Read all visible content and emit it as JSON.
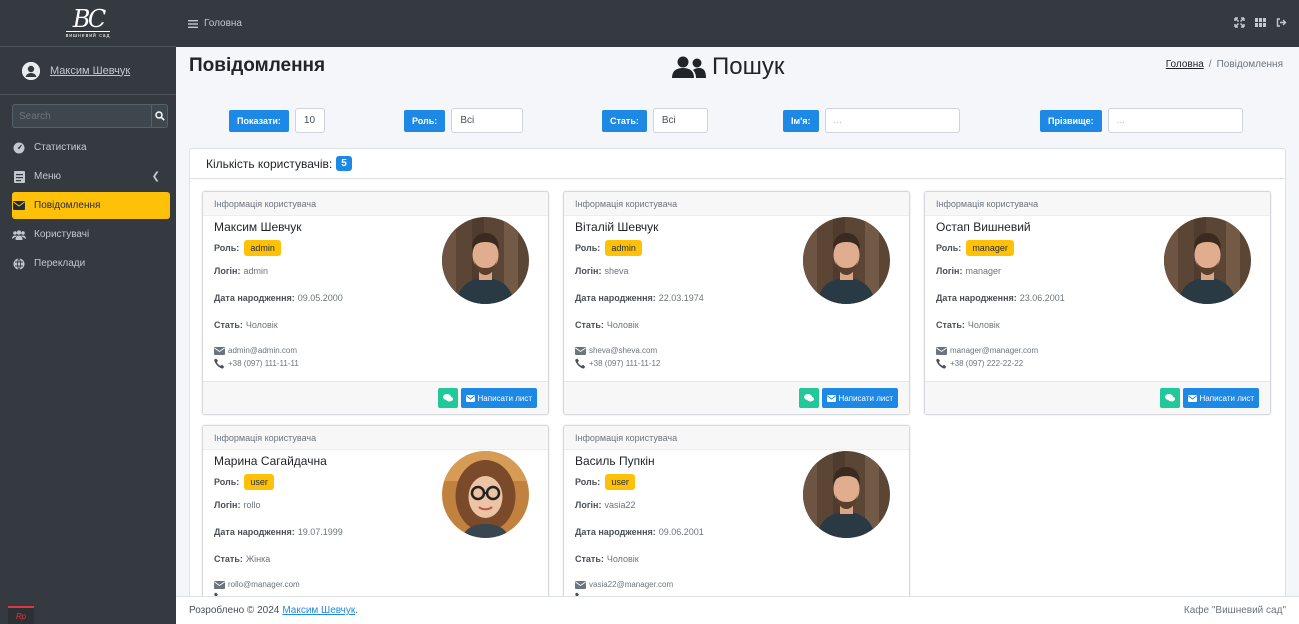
{
  "brand": {
    "logo_text": "BC",
    "logo_sub": "вишневий сад"
  },
  "sidebar": {
    "user_name": "Максим Шевчук",
    "search_placeholder": "Search",
    "items": [
      {
        "label": "Статистика",
        "icon": "gauge-icon",
        "active": false
      },
      {
        "label": "Меню",
        "icon": "list-icon",
        "active": false
      },
      {
        "label": "Повідомлення",
        "icon": "envelope-icon",
        "active": true
      },
      {
        "label": "Користувачі",
        "icon": "users-icon",
        "active": false
      },
      {
        "label": "Переклади",
        "icon": "globe-icon",
        "active": false
      }
    ]
  },
  "topbar": {
    "home_label": "Головна"
  },
  "page": {
    "title": "Повідомлення",
    "center_title": "Пошук",
    "breadcrumb": {
      "home": "Головна",
      "separator": "/",
      "current": "Повідомлення"
    }
  },
  "filters": {
    "show": {
      "label": "Показати:",
      "value": "10"
    },
    "role": {
      "label": "Роль:",
      "value": "Всі"
    },
    "sex": {
      "label": "Стать:",
      "value": "Всі"
    },
    "name": {
      "label": "Ім'я:",
      "placeholder": "..."
    },
    "surname": {
      "label": "Прізвище:",
      "placeholder": "..."
    }
  },
  "panel": {
    "count_label": "Кількість користувачів:",
    "count": "5"
  },
  "card_labels": {
    "header": "Інформація користувача",
    "role": "Роль:",
    "login": "Логін:",
    "birth": "Дата народження:",
    "sex": "Стать:",
    "write_button": "Написати лист"
  },
  "users": [
    {
      "name": "Максим Шевчук",
      "role": "admin",
      "login": "admin",
      "birth": "09.05.2000",
      "sex": "Чоловік",
      "email": "admin@admin.com",
      "phone": "+38 (097) 111-11-11",
      "photo": "man"
    },
    {
      "name": "Віталій Шевчук",
      "role": "admin",
      "login": "sheva",
      "birth": "22.03.1974",
      "sex": "Чоловік",
      "email": "sheva@sheva.com",
      "phone": "+38 (097) 111-11-12",
      "photo": "man"
    },
    {
      "name": "Остап Вишневий",
      "role": "manager",
      "login": "manager",
      "birth": "23.06.2001",
      "sex": "Чоловік",
      "email": "manager@manager.com",
      "phone": "+38 (097) 222-22-22",
      "photo": "man"
    },
    {
      "name": "Марина Сагайдачна",
      "role": "user",
      "login": "rollo",
      "birth": "19.07.1999",
      "sex": "Жінка",
      "email": "rollo@manager.com",
      "phone": "",
      "photo": "woman"
    },
    {
      "name": "Василь Пупкін",
      "role": "user",
      "login": "vasia22",
      "birth": "09.06.2001",
      "sex": "Чоловік",
      "email": "vasia22@manager.com",
      "phone": "",
      "photo": "man"
    }
  ],
  "footer": {
    "developed": "Розроблено © 2024",
    "author": "Максим Шевчук",
    "author_suffix": ".",
    "right": "Кафе \"Вишневий сад\""
  },
  "colors": {
    "sidebar": "#343a40",
    "accent": "#ffc107",
    "primary": "#1e88e5",
    "success": "#20c997"
  }
}
